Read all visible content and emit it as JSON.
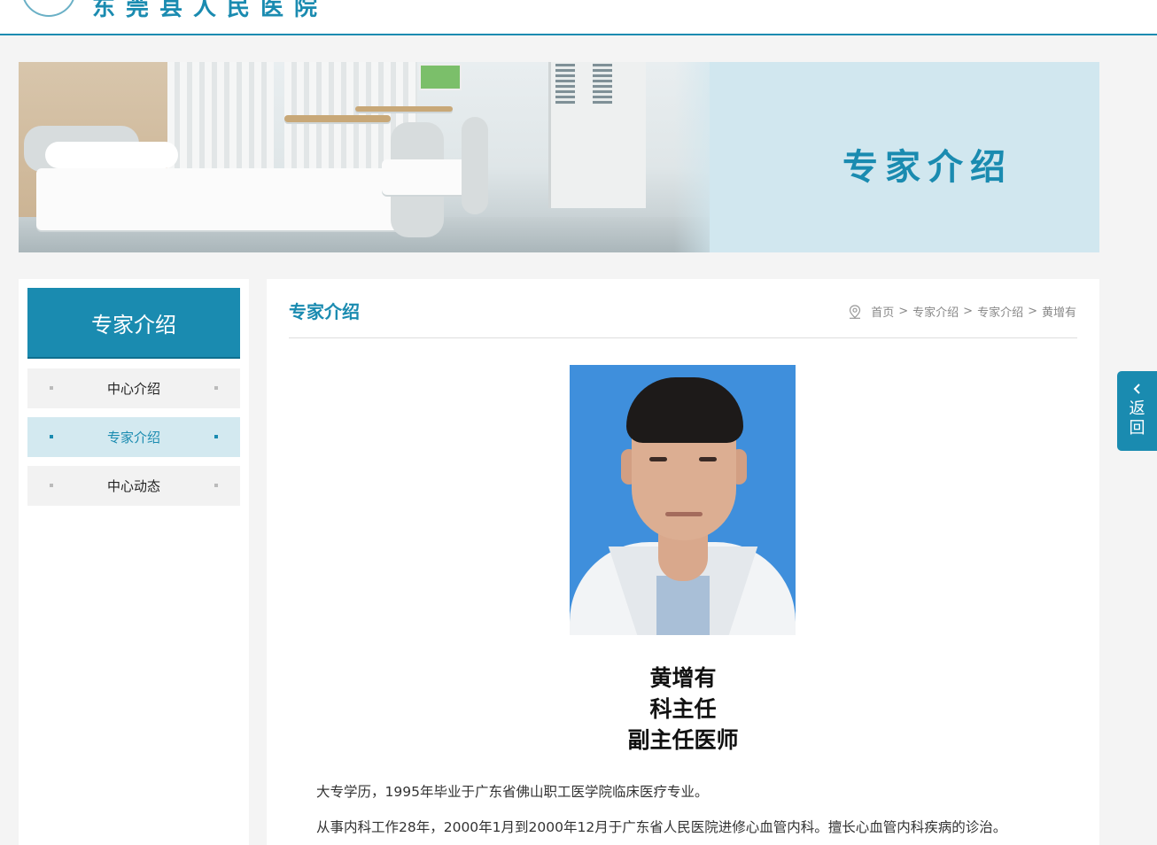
{
  "header": {
    "site_name": "东莞县人民医院",
    "accent_color": "#1a8bb0"
  },
  "banner": {
    "title": "专家介绍"
  },
  "sidebar": {
    "title": "专家介绍",
    "items": [
      {
        "label": "中心介绍",
        "active": false
      },
      {
        "label": "专家介绍",
        "active": true
      },
      {
        "label": "中心动态",
        "active": false
      }
    ]
  },
  "main": {
    "title": "专家介绍",
    "breadcrumb": {
      "icon": "location-pin-icon",
      "items": [
        "首页",
        "专家介绍",
        "专家介绍",
        "黄增有"
      ],
      "separator": ">"
    },
    "doctor": {
      "name": "黄增有",
      "position": "科主任",
      "rank": "副主任医师"
    },
    "paragraphs": [
      "大专学历，1995年毕业于广东省佛山职工医学院临床医疗专业。",
      "从事内科工作28年，2000年1月到2000年12月于广东省人民医院进修心血管内科。擅长心血管内科疾病的诊治。"
    ]
  },
  "float_button": {
    "label": "返回",
    "icon": "chevron-left-icon"
  }
}
